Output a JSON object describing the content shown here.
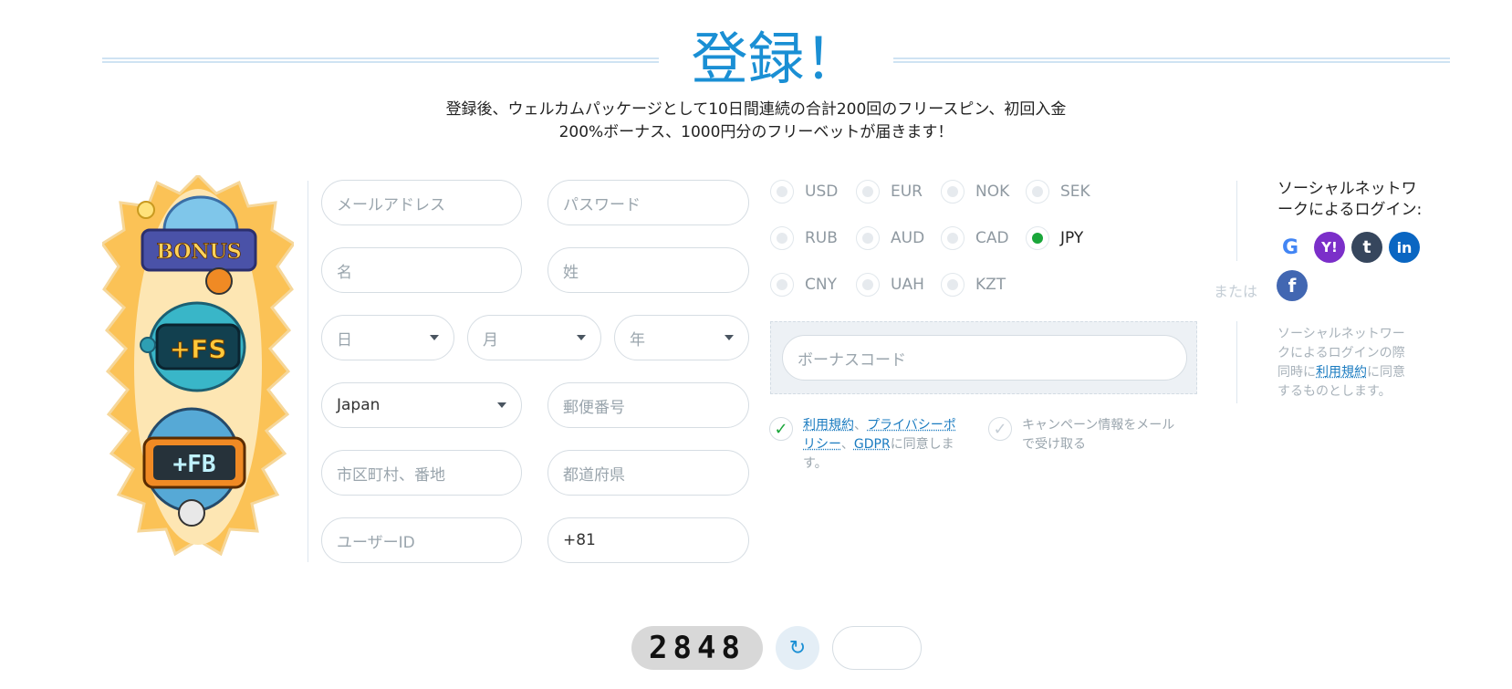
{
  "header": {
    "title": "登録！",
    "subtitle_line1": "登録後、ウェルカムパッケージとして10日間連続の合計200回のフリースピン、初回入金",
    "subtitle_line2": "200%ボーナス、1000円分のフリーベットが届きます！"
  },
  "mascots": {
    "bonus_label": "BONUS",
    "fs_label": "+FS",
    "fb_label": "+FB"
  },
  "form": {
    "email_placeholder": "メールアドレス",
    "password_placeholder": "パスワード",
    "first_name_placeholder": "名",
    "last_name_placeholder": "姓",
    "day_placeholder": "日",
    "month_placeholder": "月",
    "year_placeholder": "年",
    "country_value": "Japan",
    "postal_placeholder": "郵便番号",
    "city_placeholder": "市区町村、番地",
    "prefecture_placeholder": "都道府県",
    "user_id_placeholder": "ユーザーID",
    "phone_code_value": "+81"
  },
  "currencies": {
    "items": [
      "USD",
      "EUR",
      "NOK",
      "SEK",
      "RUB",
      "AUD",
      "CAD",
      "JPY",
      "CNY",
      "UAH",
      "KZT"
    ],
    "selected": "JPY"
  },
  "bonus": {
    "placeholder": "ボーナスコード"
  },
  "terms": {
    "link_terms": "利用規約",
    "sep1": "、",
    "link_privacy_a": "プライバシーポ",
    "link_privacy_b": "リシー",
    "sep2": "、",
    "link_gdpr": "GDPR",
    "suffix_a": "に同意しま",
    "suffix_b": "す。"
  },
  "campaign": {
    "line1": "キャンペーン情報をメール",
    "line2": "で受け取る"
  },
  "social": {
    "title_line1": "ソーシャルネットワ",
    "title_line2": "ークによるログイン:",
    "or_label": "または",
    "icons": [
      "google-icon",
      "yahoo-icon",
      "tumblr-icon",
      "linkedin-icon",
      "facebook-icon"
    ],
    "google": "G",
    "yahoo": "Y!",
    "tumblr": "t",
    "linkedin": "in",
    "facebook": "f",
    "note_line1": "ソーシャルネットワー",
    "note_line2": "クによるログインの際",
    "note_line3_pre": "同時に",
    "note_link": "利用規約",
    "note_line3_post": "に同意",
    "note_line4": "するものとします。"
  },
  "captcha": {
    "code": "2848",
    "refresh_icon": "refresh-icon"
  },
  "colors": {
    "accent": "#1a8fd4",
    "selected": "#1aa63a",
    "link": "#1a7bc0"
  }
}
